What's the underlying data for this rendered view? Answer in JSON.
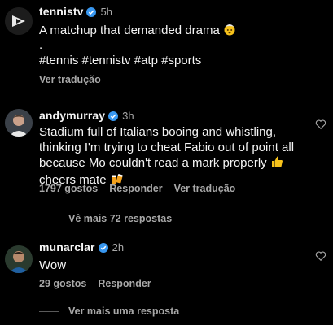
{
  "comments": [
    {
      "username": "tennistv",
      "time": "5h",
      "line1": "A matchup that demanded drama",
      "line2": ".",
      "line3": "#tennis #tennistv #atp #sports",
      "see_translation": "Ver tradução",
      "avatar_icon": "tennistv-logo-icon"
    },
    {
      "username": "andymurray",
      "time": "3h",
      "lines": [
        "Stadium full of Italians booing and whistling,",
        "thinking I'm trying to cheat Fabio out of point all",
        "because Mo couldn't read a mark properly",
        "cheers mate"
      ],
      "likes": "1797 gostos",
      "reply": "Responder",
      "see_translation": "Ver tradução",
      "view_replies": "Vê mais 72 respostas"
    },
    {
      "username": "munarclar",
      "time": "2h",
      "text": "Wow",
      "likes": "29 gostos",
      "reply": "Responder",
      "view_replies": "Ver mais uma resposta"
    }
  ],
  "colors": {
    "background": "#000000",
    "text": "#f5f5f5",
    "muted": "#a8a8a8",
    "verified": "#3897f0"
  }
}
